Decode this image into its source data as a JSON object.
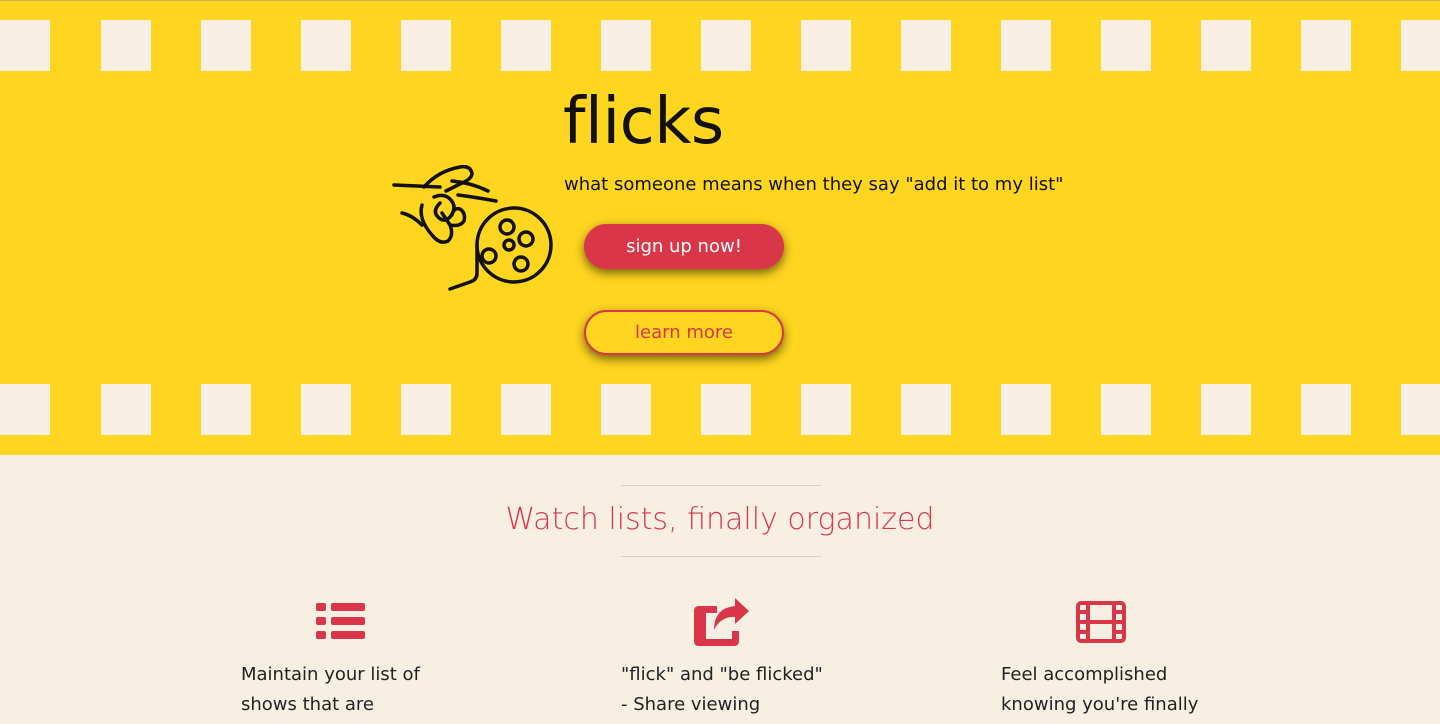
{
  "hero": {
    "title": "flicks",
    "tagline": "what someone means when they say \"add it to my list\"",
    "illustration_icon": "hand-flicking-film-reel-icon",
    "signup_label": "sign up now!",
    "learn_more_label": "learn more"
  },
  "features_section": {
    "title": "Watch lists, finally organized",
    "items": [
      {
        "icon": "list-icon",
        "text": "Maintain your list of shows that are"
      },
      {
        "icon": "share-icon",
        "text": "\"flick\" and \"be flicked\" - Share viewing"
      },
      {
        "icon": "film-icon",
        "text": "Feel accomplished knowing you're finally"
      }
    ]
  },
  "colors": {
    "hero_background": "#fed51f",
    "page_background": "#f6efe2",
    "accent": "#d9364a",
    "text": "#111111"
  }
}
